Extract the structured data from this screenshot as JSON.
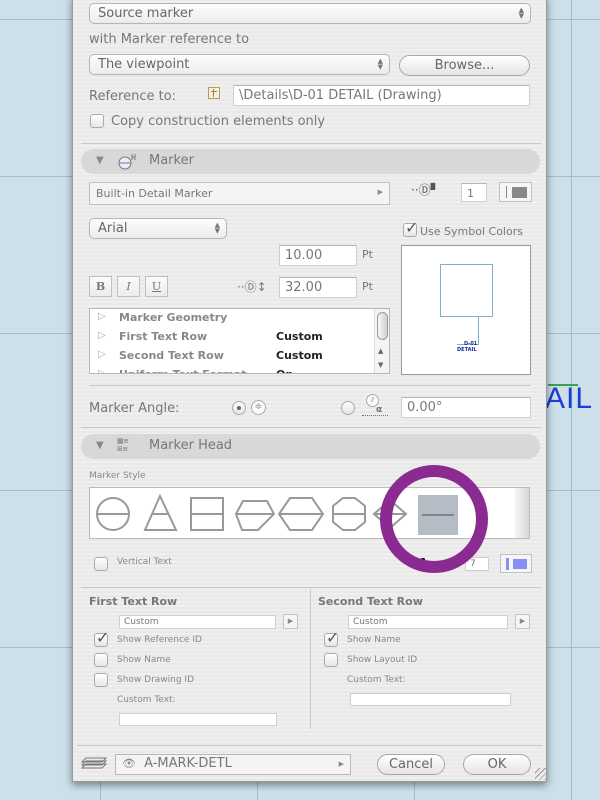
{
  "background": {
    "drawing_text": "AIL",
    "grid_color": "#9dbfd6",
    "text_color": "#1a3fd6"
  },
  "source": {
    "source_popup": "Source marker",
    "reference_label": "with Marker reference to",
    "reference_popup": "The viewpoint",
    "browse_button": "Browse...",
    "reference_to_label": "Reference to:",
    "reference_to_value": "\\Details\\D-01 DETAIL (Drawing)",
    "copy_construction_label": "Copy construction elements only",
    "copy_construction_checked": false
  },
  "marker": {
    "section_title": "Marker",
    "marker_type": "Built-in Detail Marker",
    "pen_number": "1",
    "font": "Arial",
    "use_symbol_colors_label": "Use Symbol Colors",
    "use_symbol_colors_checked": true,
    "text_size": "10.00",
    "text_size_unit": "Pt",
    "marker_size": "32.00",
    "marker_size_unit": "Pt",
    "style_buttons": {
      "bold": "B",
      "italic": "I",
      "underline": "U"
    },
    "settings_list": [
      {
        "name": "Marker Geometry",
        "value": ""
      },
      {
        "name": "First Text Row",
        "value": "Custom"
      },
      {
        "name": "Second Text Row",
        "value": "Custom"
      },
      {
        "name": "Uniform Text Format",
        "value": "On"
      }
    ],
    "preview": {
      "id_text": "D-01",
      "name_text": "DETAIL"
    },
    "angle_label": "Marker Angle:",
    "angle_value": "0.00°",
    "angle_mode": "horizontal"
  },
  "marker_head": {
    "section_title": "Marker Head",
    "style_label": "Marker Style",
    "styles": [
      "circle",
      "triangle",
      "square",
      "pentagon",
      "hexagon",
      "octagon",
      "diamond",
      "line"
    ],
    "selected_style": "line",
    "highlight_color": "#8b2a91",
    "vertical_text_label": "Vertical Text",
    "vertical_text_checked": false,
    "text_pen": "7",
    "pen_color": "#8a8ff5"
  },
  "first_text_row": {
    "title": "First Text Row",
    "popup": "Custom",
    "options": [
      {
        "label": "Show Reference ID",
        "checked": true
      },
      {
        "label": "Show Name",
        "checked": false
      },
      {
        "label": "Show Drawing ID",
        "checked": false
      }
    ],
    "custom_text_label": "Custom Text:",
    "custom_text_value": ""
  },
  "second_text_row": {
    "title": "Second Text Row",
    "popup": "Custom",
    "options": [
      {
        "label": "Show Name",
        "checked": true
      },
      {
        "label": "Show Layout ID",
        "checked": false
      }
    ],
    "custom_text_label": "Custom Text:",
    "custom_text_value": ""
  },
  "footer": {
    "layer": "A-MARK-DETL",
    "cancel_button": "Cancel",
    "ok_button": "OK"
  }
}
